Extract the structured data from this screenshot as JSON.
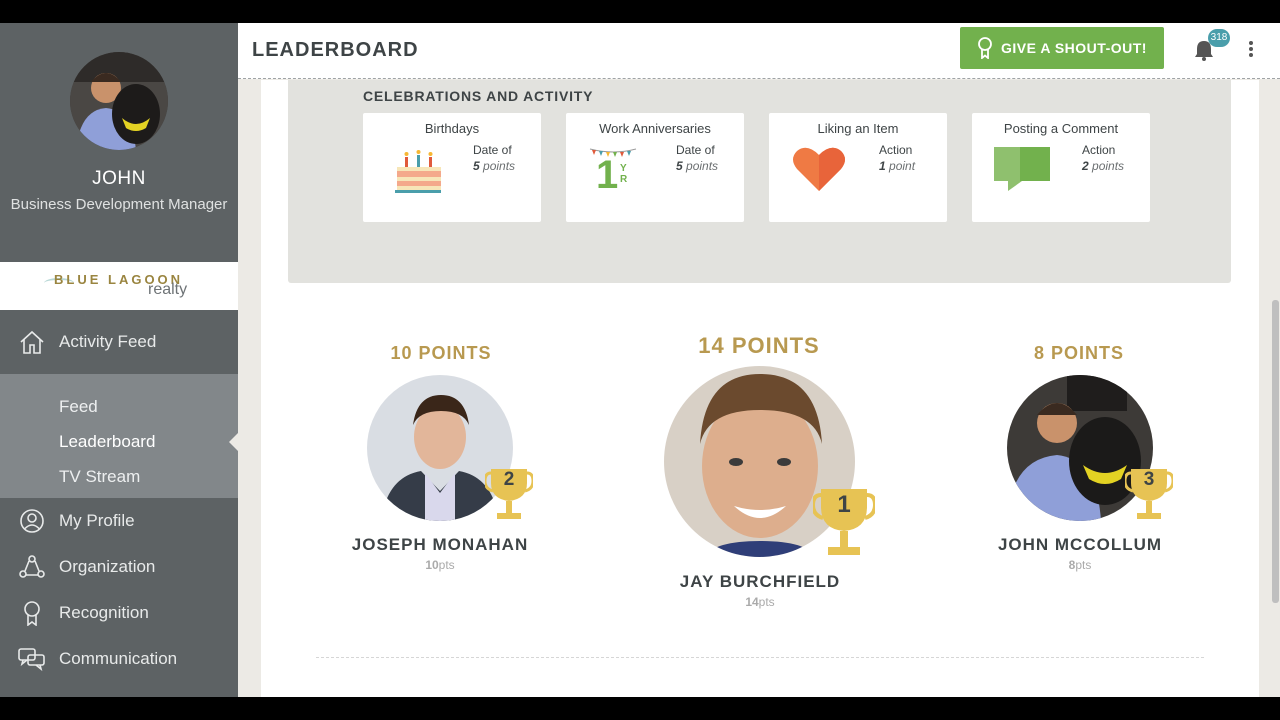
{
  "user": {
    "name": "JOHN",
    "title": "Business Development Manager"
  },
  "brand": {
    "line1": "BLUE LAGOON",
    "line2": "realty"
  },
  "nav": {
    "activity_feed": "Activity Feed",
    "sub": [
      "Feed",
      "Leaderboard",
      "TV Stream"
    ],
    "my_profile": "My Profile",
    "organization": "Organization",
    "recognition": "Recognition",
    "communication": "Communication"
  },
  "header": {
    "title": "LEADERBOARD",
    "shoutout_label": "GIVE A SHOUT-OUT!",
    "notification_count": "318"
  },
  "celebrations": {
    "title": "CELEBRATIONS AND ACTIVITY",
    "cards": [
      {
        "title": "Birthdays",
        "label": "Date of",
        "points_value": "5",
        "points_unit": "points"
      },
      {
        "title": "Work Anniversaries",
        "label": "Date of",
        "points_value": "5",
        "points_unit": "points",
        "badge_num": "1",
        "badge_txt": "YR"
      },
      {
        "title": "Liking an Item",
        "label": "Action",
        "points_value": "1",
        "points_unit": "point"
      },
      {
        "title": "Posting a Comment",
        "label": "Action",
        "points_value": "2",
        "points_unit": "points"
      }
    ]
  },
  "leaders": [
    {
      "rank": "2",
      "points_label": "10 POINTS",
      "name": "JOSEPH MONAHAN",
      "pts_value": "10",
      "pts_unit": "pts"
    },
    {
      "rank": "1",
      "points_label": "14 POINTS",
      "name": "JAY BURCHFIELD",
      "pts_value": "14",
      "pts_unit": "pts"
    },
    {
      "rank": "3",
      "points_label": "8 POINTS",
      "name": "JOHN MCCOLLUM",
      "pts_value": "8",
      "pts_unit": "pts"
    }
  ],
  "colors": {
    "gold": "#b89950",
    "accent_green": "#72b14d",
    "sidebar": "#5d6264",
    "badge": "#4a9eab"
  }
}
